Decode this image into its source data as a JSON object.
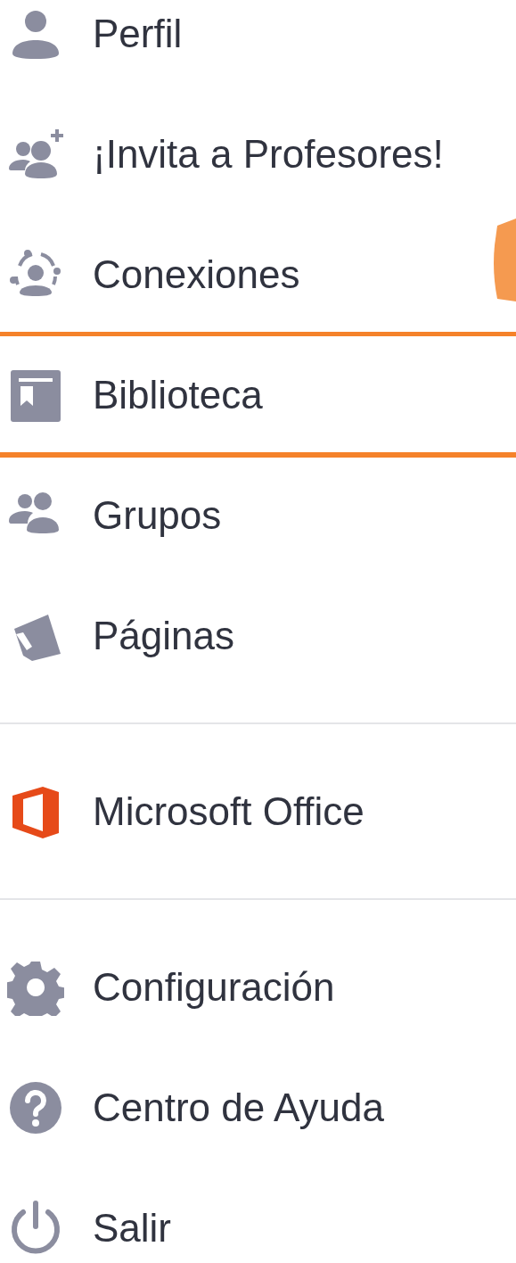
{
  "menu": {
    "sections": [
      {
        "items": [
          {
            "label": "Perfil",
            "highlighted": false
          },
          {
            "label": "¡Invita a Profesores!",
            "highlighted": false
          },
          {
            "label": "Conexiones",
            "highlighted": false
          },
          {
            "label": "Biblioteca",
            "highlighted": true
          },
          {
            "label": "Grupos",
            "highlighted": false
          },
          {
            "label": "Páginas",
            "highlighted": false
          }
        ]
      },
      {
        "items": [
          {
            "label": "Microsoft Office",
            "highlighted": false
          }
        ]
      },
      {
        "items": [
          {
            "label": "Configuración",
            "highlighted": false
          },
          {
            "label": "Centro de Ayuda",
            "highlighted": false
          },
          {
            "label": "Salir",
            "highlighted": false
          }
        ]
      }
    ]
  }
}
